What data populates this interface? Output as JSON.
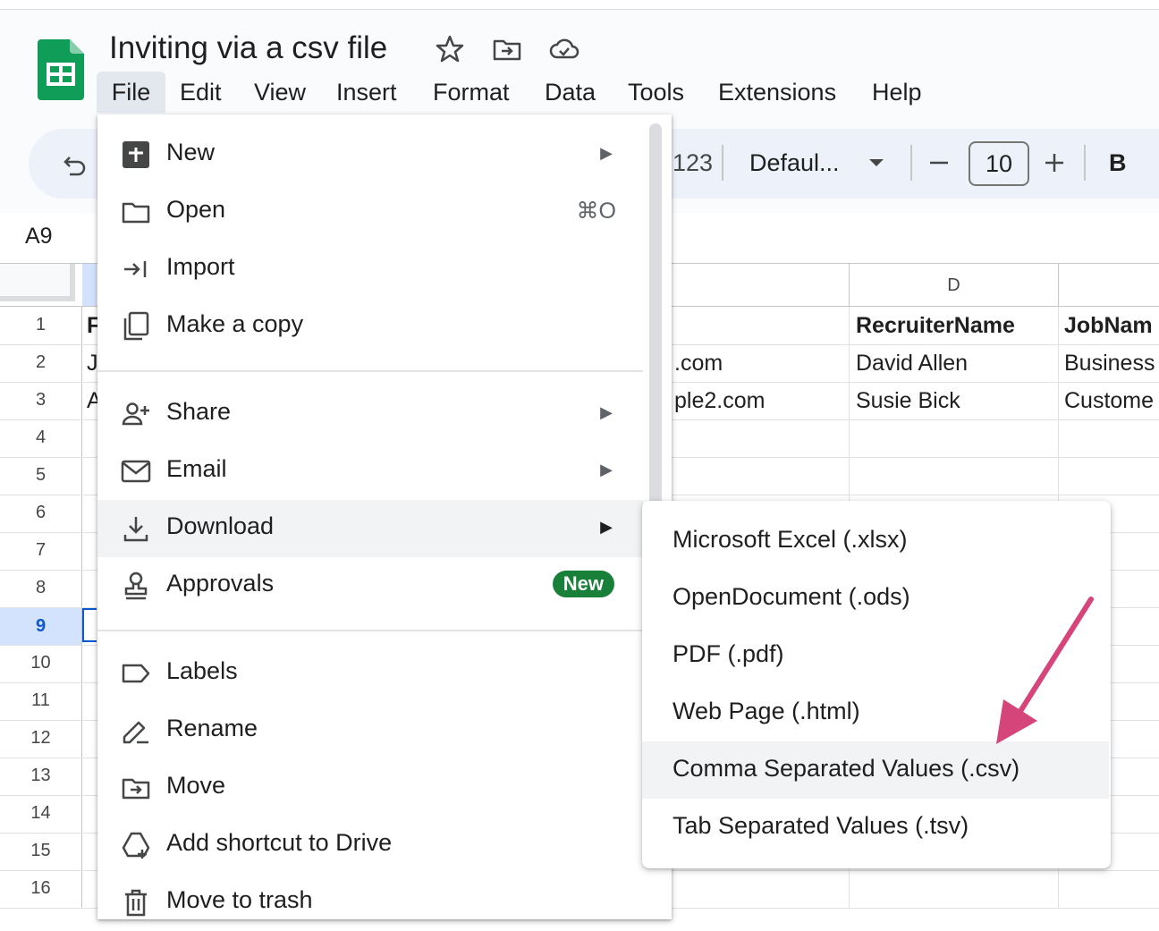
{
  "document": {
    "title": "Inviting via a csv file"
  },
  "menubar": [
    "File",
    "Edit",
    "View",
    "Insert",
    "Format",
    "Data",
    "Tools",
    "Extensions",
    "Help"
  ],
  "toolbar": {
    "number_format": "123",
    "font": "Defaul...",
    "font_size": "10",
    "bold": "B"
  },
  "name_box": "A9",
  "columns": {
    "d": "D"
  },
  "rows": [
    "1",
    "2",
    "3",
    "4",
    "5",
    "6",
    "7",
    "8",
    "9",
    "10",
    "11",
    "12",
    "13",
    "14",
    "15",
    "16"
  ],
  "cells": {
    "a1": "F",
    "a2": "J",
    "a3": "A",
    "c2": ".com",
    "c3": "ple2.com",
    "d1": "RecruiterName",
    "d2": "David Allen",
    "d3": "Susie Bick",
    "e1": "JobNam",
    "e2": "Business",
    "e3": "Custome"
  },
  "file_menu": {
    "new": "New",
    "open": "Open",
    "open_shortcut": "⌘O",
    "import": "Import",
    "make_copy": "Make a copy",
    "share": "Share",
    "email": "Email",
    "download": "Download",
    "approvals": "Approvals",
    "approvals_badge": "New",
    "labels": "Labels",
    "rename": "Rename",
    "move": "Move",
    "add_shortcut": "Add shortcut to Drive",
    "move_to_trash": "Move to trash"
  },
  "download_menu": [
    "Microsoft Excel (.xlsx)",
    "OpenDocument (.ods)",
    "PDF (.pdf)",
    "Web Page (.html)",
    "Comma Separated Values (.csv)",
    "Tab Separated Values (.tsv)"
  ],
  "colors": {
    "accent": "#0b57d0",
    "sheets_green": "#0f9d58",
    "badge_green": "#188038",
    "annotation_arrow": "#d6457a"
  }
}
